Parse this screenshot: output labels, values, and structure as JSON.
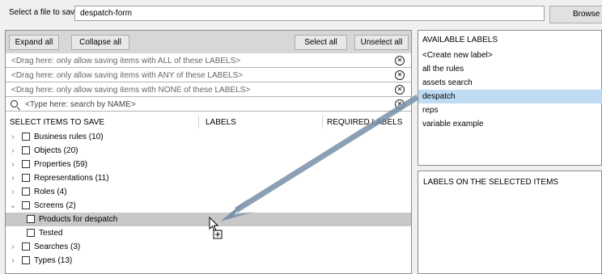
{
  "file": {
    "label": "Select a file to save",
    "value": "despatch-form",
    "browse_label": "Browse"
  },
  "toolbar": {
    "expand_all": "Expand all",
    "collapse_all": "Collapse all",
    "select_all": "Select all",
    "unselect_all": "Unselect all"
  },
  "filters": {
    "all": "<Drag here: only allow saving items with ALL of these LABELS>",
    "any": "<Drag here: only allow saving items with ANY of these LABELS>",
    "none": "<Drag here: only allow saving items with NONE of these LABELS>",
    "search_placeholder": "<Type here: search by NAME>"
  },
  "columns": {
    "items": "SELECT ITEMS TO SAVE",
    "labels": "LABELS",
    "required": "REQUIRED LABELS"
  },
  "tree": [
    {
      "label": "Business rules (10)"
    },
    {
      "label": "Objects (20)"
    },
    {
      "label": "Properties (59)"
    },
    {
      "label": "Representations (11)"
    },
    {
      "label": "Roles (4)"
    },
    {
      "label": "Screens (2)"
    },
    {
      "label": "Products for despatch"
    },
    {
      "label": "Tested"
    },
    {
      "label": "Searches (3)"
    },
    {
      "label": "Types (13)"
    }
  ],
  "available_labels": {
    "header": "AVAILABLE LABELS",
    "items": [
      "<Create new label>",
      "all the rules",
      "assets search",
      "despatch",
      "reps",
      "variable example"
    ],
    "selected": "despatch"
  },
  "selected_item_labels": {
    "header": "LABELS ON THE SELECTED ITEMS"
  },
  "colors": {
    "selected_row": "#c8c8c8",
    "selected_label": "#bfdcf4",
    "drag_arrow": "#7890a8"
  }
}
